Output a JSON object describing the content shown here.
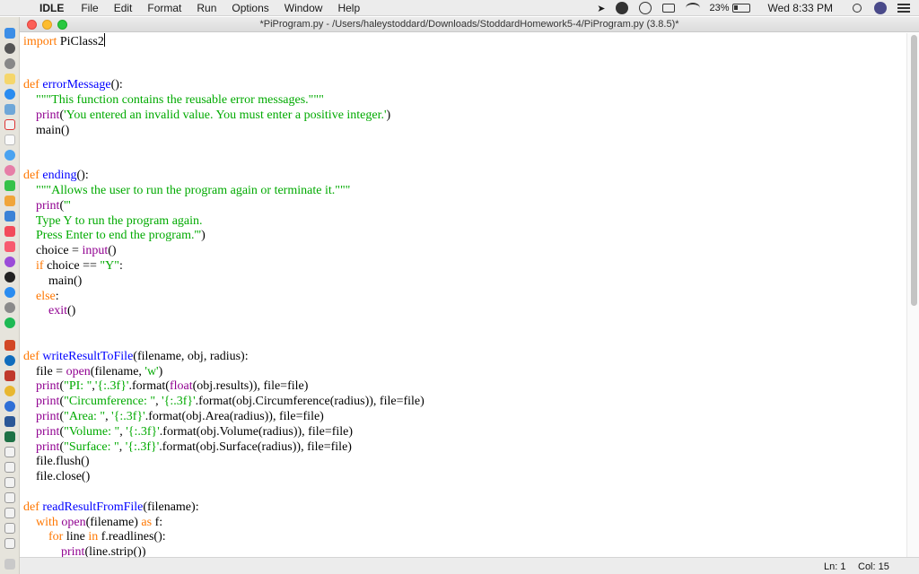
{
  "menubar": {
    "app_name": "IDLE",
    "menus": [
      "File",
      "Edit",
      "Format",
      "Run",
      "Options",
      "Window",
      "Help"
    ],
    "battery_percent": "23%",
    "clock": "Wed 8:33 PM"
  },
  "window": {
    "title": "*PiProgram.py - /Users/haleystoddard/Downloads/StoddardHomework5-4/PiProgram.py (3.8.5)*"
  },
  "editor": {
    "lines": [
      [
        {
          "t": "import",
          "c": "k"
        },
        {
          "t": " PiClass2"
        }
      ],
      [],
      [],
      [
        {
          "t": "def",
          "c": "k"
        },
        {
          "t": " "
        },
        {
          "t": "errorMessage",
          "c": "d"
        },
        {
          "t": "():"
        }
      ],
      [
        {
          "t": "    "
        },
        {
          "t": "\"\"\"This function contains the reusable error messages.\"\"\"",
          "c": "s"
        }
      ],
      [
        {
          "t": "    "
        },
        {
          "t": "print",
          "c": "b"
        },
        {
          "t": "("
        },
        {
          "t": "'You entered an invalid value. You must enter a positive integer.'",
          "c": "s"
        },
        {
          "t": ")"
        }
      ],
      [
        {
          "t": "    main()"
        }
      ],
      [],
      [],
      [
        {
          "t": "def",
          "c": "k"
        },
        {
          "t": " "
        },
        {
          "t": "ending",
          "c": "d"
        },
        {
          "t": "():"
        }
      ],
      [
        {
          "t": "    "
        },
        {
          "t": "\"\"\"Allows the user to run the program again or terminate it.\"\"\"",
          "c": "s"
        }
      ],
      [
        {
          "t": "    "
        },
        {
          "t": "print",
          "c": "b"
        },
        {
          "t": "("
        },
        {
          "t": "'''",
          "c": "s"
        }
      ],
      [
        {
          "t": "    "
        },
        {
          "t": "Type Y to run the program again.",
          "c": "s"
        }
      ],
      [
        {
          "t": "    "
        },
        {
          "t": "Press Enter to end the program.'''",
          "c": "s"
        },
        {
          "t": ")"
        }
      ],
      [
        {
          "t": "    choice = "
        },
        {
          "t": "input",
          "c": "b"
        },
        {
          "t": "()"
        }
      ],
      [
        {
          "t": "    "
        },
        {
          "t": "if",
          "c": "k"
        },
        {
          "t": " choice == "
        },
        {
          "t": "\"Y\"",
          "c": "s"
        },
        {
          "t": ":"
        }
      ],
      [
        {
          "t": "        main()"
        }
      ],
      [
        {
          "t": "    "
        },
        {
          "t": "else",
          "c": "k"
        },
        {
          "t": ":"
        }
      ],
      [
        {
          "t": "        "
        },
        {
          "t": "exit",
          "c": "b"
        },
        {
          "t": "()"
        }
      ],
      [],
      [],
      [
        {
          "t": "def",
          "c": "k"
        },
        {
          "t": " "
        },
        {
          "t": "writeResultToFile",
          "c": "d"
        },
        {
          "t": "(filename, obj, radius):"
        }
      ],
      [
        {
          "t": "    file = "
        },
        {
          "t": "open",
          "c": "b"
        },
        {
          "t": "(filename, "
        },
        {
          "t": "'w'",
          "c": "s"
        },
        {
          "t": ")"
        }
      ],
      [
        {
          "t": "    "
        },
        {
          "t": "print",
          "c": "b"
        },
        {
          "t": "("
        },
        {
          "t": "\"PI: \"",
          "c": "s"
        },
        {
          "t": ","
        },
        {
          "t": "'{:.3f}'",
          "c": "s"
        },
        {
          "t": ".format("
        },
        {
          "t": "float",
          "c": "b"
        },
        {
          "t": "(obj.results)), file=file)"
        }
      ],
      [
        {
          "t": "    "
        },
        {
          "t": "print",
          "c": "b"
        },
        {
          "t": "("
        },
        {
          "t": "\"Circumference: \"",
          "c": "s"
        },
        {
          "t": ", "
        },
        {
          "t": "'{:.3f}'",
          "c": "s"
        },
        {
          "t": ".format(obj.Circumference(radius)), file=file)"
        }
      ],
      [
        {
          "t": "    "
        },
        {
          "t": "print",
          "c": "b"
        },
        {
          "t": "("
        },
        {
          "t": "\"Area: \"",
          "c": "s"
        },
        {
          "t": ", "
        },
        {
          "t": "'{:.3f}'",
          "c": "s"
        },
        {
          "t": ".format(obj.Area(radius)), file=file)"
        }
      ],
      [
        {
          "t": "    "
        },
        {
          "t": "print",
          "c": "b"
        },
        {
          "t": "("
        },
        {
          "t": "\"Volume: \"",
          "c": "s"
        },
        {
          "t": ", "
        },
        {
          "t": "'{:.3f}'",
          "c": "s"
        },
        {
          "t": ".format(obj.Volume(radius)), file=file)"
        }
      ],
      [
        {
          "t": "    "
        },
        {
          "t": "print",
          "c": "b"
        },
        {
          "t": "("
        },
        {
          "t": "\"Surface: \"",
          "c": "s"
        },
        {
          "t": ", "
        },
        {
          "t": "'{:.3f}'",
          "c": "s"
        },
        {
          "t": ".format(obj.Surface(radius)), file=file)"
        }
      ],
      [
        {
          "t": "    file.flush()"
        }
      ],
      [
        {
          "t": "    file.close()"
        }
      ],
      [],
      [
        {
          "t": "def",
          "c": "k"
        },
        {
          "t": " "
        },
        {
          "t": "readResultFromFile",
          "c": "d"
        },
        {
          "t": "(filename):"
        }
      ],
      [
        {
          "t": "    "
        },
        {
          "t": "with",
          "c": "k"
        },
        {
          "t": " "
        },
        {
          "t": "open",
          "c": "b"
        },
        {
          "t": "(filename) "
        },
        {
          "t": "as",
          "c": "k"
        },
        {
          "t": " f:"
        }
      ],
      [
        {
          "t": "        "
        },
        {
          "t": "for",
          "c": "k"
        },
        {
          "t": " line "
        },
        {
          "t": "in",
          "c": "k"
        },
        {
          "t": " f.readlines():"
        }
      ],
      [
        {
          "t": "            "
        },
        {
          "t": "print",
          "c": "b"
        },
        {
          "t": "(line.strip())"
        }
      ]
    ]
  },
  "statusbar": {
    "ln": "Ln: 1",
    "col": "Col: 15"
  },
  "scroll_fraction_visible": 0.52
}
